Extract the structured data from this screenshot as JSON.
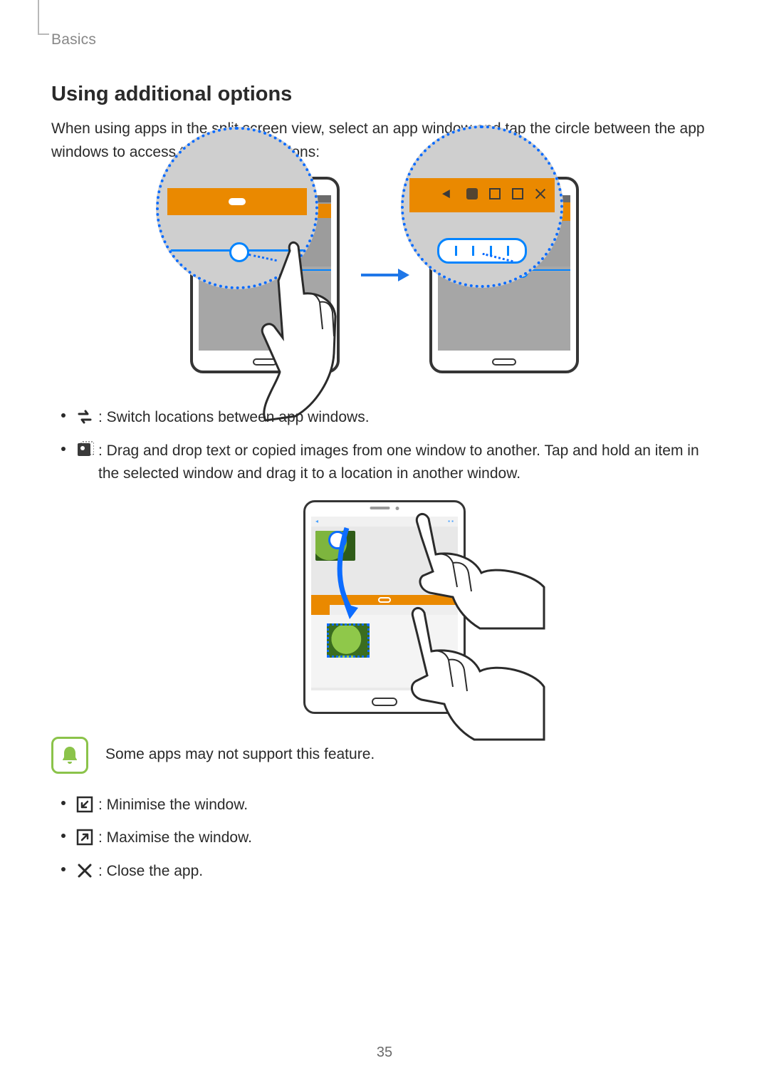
{
  "section_label": "Basics",
  "heading": "Using additional options",
  "intro": "When using apps in the split screen view, select an app window and tap the circle between the app windows to access the following options:",
  "options": {
    "switch": ": Switch locations between app windows.",
    "drag": ": Drag and drop text or copied images from one window to another. Tap and hold an item in the selected window and drag it to a location in another window.",
    "minimise": ": Minimise the window.",
    "maximise": ": Maximise the window.",
    "close": ": Close the app."
  },
  "note": "Some apps may not support this feature.",
  "page_number": "35"
}
